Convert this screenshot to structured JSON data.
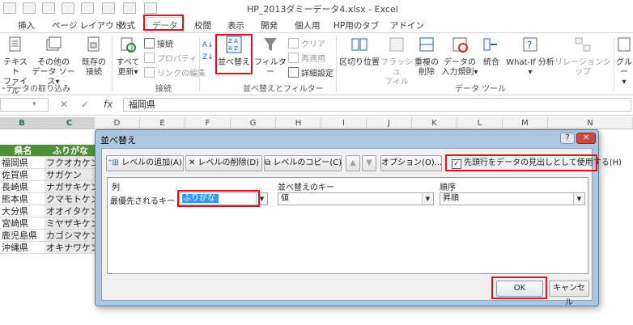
{
  "window": {
    "title": "HP_2013ダミーデータ4.xlsx - Excel"
  },
  "tabs": [
    {
      "label": "挿入"
    },
    {
      "label": "ページ レイアウト"
    },
    {
      "label": "数式"
    },
    {
      "label": "データ"
    },
    {
      "label": "校閲"
    },
    {
      "label": "表示"
    },
    {
      "label": "開発"
    },
    {
      "label": "個人用"
    },
    {
      "label": "HP用のタブ"
    },
    {
      "label": "アドイン"
    }
  ],
  "ribbon": {
    "get_external": {
      "text_file": [
        "テキスト",
        "ファイル"
      ],
      "other_sources": [
        "その他の",
        "データ ソース▾"
      ],
      "existing": [
        "既存の",
        "接続"
      ],
      "group_label": "ｰデータの取り込み"
    },
    "connections": {
      "refresh_all": [
        "すべて",
        "更新▾"
      ],
      "connections": "接続",
      "properties": "プロパティ",
      "edit_links": "リンクの編集",
      "group_label": "接続"
    },
    "sort_filter": {
      "sort": "並べ替え",
      "filter": "フィルター",
      "clear": "クリア",
      "reapply": "再適用",
      "advanced": "詳細設定",
      "group_label": "並べ替えとフィルター"
    },
    "data_tools": {
      "text_to_columns": "区切り位置",
      "flash_fill": [
        "フラッシュ",
        "フィル"
      ],
      "remove_duplicates": [
        "重複の",
        "削除"
      ],
      "validation": [
        "データの",
        "入力規則▾"
      ],
      "consolidate": "統合",
      "what_if": [
        "What-If 分析",
        "▾"
      ],
      "relationships": "リレーションシップ",
      "group_label": "データ ツール"
    },
    "outline": {
      "group": [
        "グルー",
        "▾"
      ]
    }
  },
  "formula_bar": {
    "content": "福岡県"
  },
  "columns": [
    "B",
    "C",
    "D",
    "E",
    "F",
    "G",
    "H",
    "I",
    "J",
    "K",
    "L",
    "M",
    "N"
  ],
  "sheet": {
    "header": {
      "b": "県名",
      "c": "ふりがな"
    },
    "rows": [
      {
        "b": "福岡県",
        "c": "フクオカケン"
      },
      {
        "b": "佐賀県",
        "c": "サガケン"
      },
      {
        "b": "長崎県",
        "c": "ナガサキケン"
      },
      {
        "b": "熊本県",
        "c": "クマモトケン"
      },
      {
        "b": "大分県",
        "c": "オオイタケン"
      },
      {
        "b": "宮崎県",
        "c": "ミヤザキケン"
      },
      {
        "b": "鹿児島県",
        "c": "カゴシマケン"
      },
      {
        "b": "沖縄県",
        "c": "オキナワケン"
      }
    ]
  },
  "dialog": {
    "title": "並べ替え",
    "help": "?",
    "close": "✕",
    "buttons": {
      "add_level": "レベルの追加(A)",
      "delete_level": "レベルの削除(D)",
      "copy_level": "レベルのコピー(C)",
      "options": "オプション(O)..."
    },
    "header_checkbox": {
      "label": "先頭行をデータの見出しとして使用する(H)",
      "checked": true,
      "mark": "✓"
    },
    "list_headers": {
      "column": "列",
      "sort_on": "並べ替えのキー",
      "order": "順序"
    },
    "row": {
      "label": "最優先されるキー",
      "column": "ふりがな",
      "sort_on": "値",
      "order": "昇順"
    },
    "ok": "OK",
    "cancel": "キャンセル"
  }
}
